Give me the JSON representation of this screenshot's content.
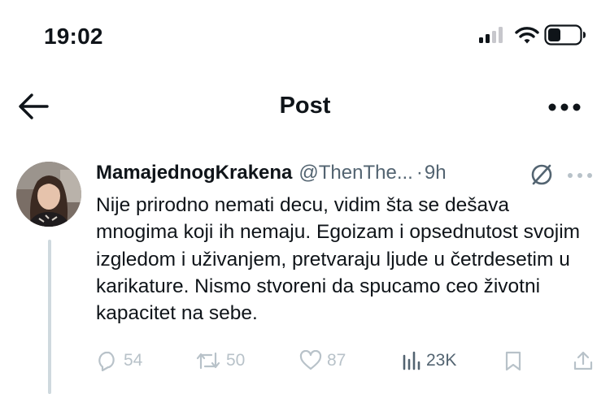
{
  "status_bar": {
    "time": "19:02"
  },
  "header": {
    "title": "Post"
  },
  "tweet": {
    "display_name": "MamajednogKrakena",
    "handle": "@ThenThe...",
    "separator": "·",
    "age": "9h",
    "text": "Nije prirodno nemati decu, vidim šta se dešava mnogima koji ih nemaju. Egoizam i opsednutost svojim izgledom i uživanjem, pretvaraju ljude u četrdesetim u karikature. Nismo stvoreni da spucamo ceo životni kapacitet na sebe.",
    "metrics": {
      "replies": "54",
      "reposts": "50",
      "likes": "87",
      "views": "23K"
    }
  },
  "icons": {
    "back": "back-arrow-icon",
    "more": "more-dots-icon",
    "wifi": "wifi-icon",
    "battery": "battery-icon",
    "signal": "signal-icon",
    "edit": "edited-icon",
    "reply": "reply-icon",
    "repost": "repost-icon",
    "like": "heart-icon",
    "views": "views-icon",
    "bookmark": "bookmark-icon",
    "share": "share-icon"
  },
  "colors": {
    "text": "#0f1419",
    "secondary": "#536471",
    "faded": "#b8c2c9",
    "thread": "#cfd9de"
  }
}
